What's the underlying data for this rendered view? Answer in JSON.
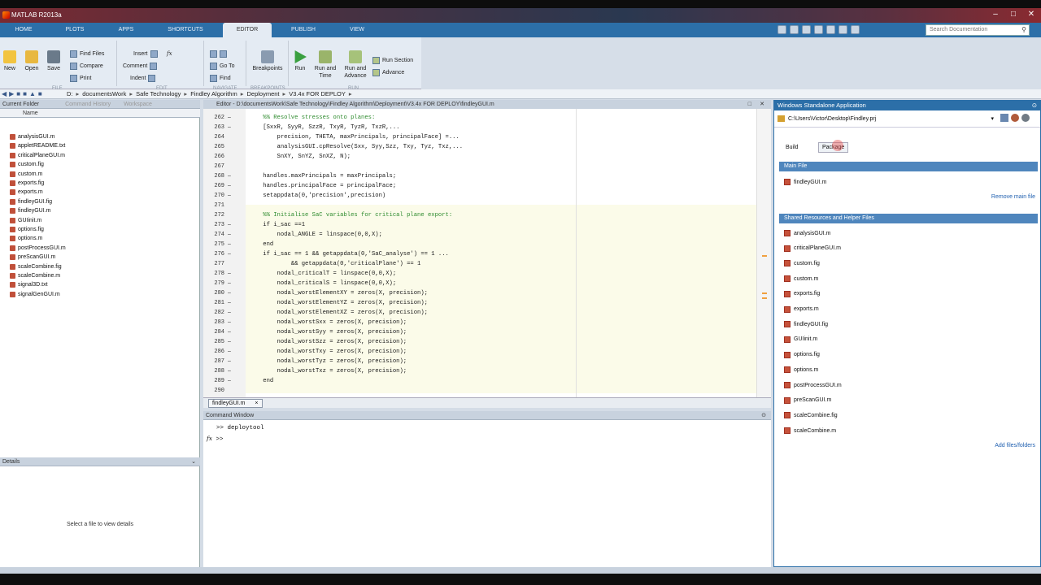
{
  "window": {
    "title": "MATLAB R2013a"
  },
  "tabs": [
    "HOME",
    "PLOTS",
    "APPS",
    "SHORTCUTS",
    "EDITOR",
    "PUBLISH",
    "VIEW"
  ],
  "active_tab": "EDITOR",
  "search": {
    "placeholder": "Search Documentation"
  },
  "ribbon": {
    "file": {
      "new": "New",
      "open": "Open",
      "save": "Save",
      "find_files": "Find Files",
      "compare": "Compare",
      "print": "Print",
      "section": "FILE"
    },
    "edit": {
      "insert": "Insert",
      "comment": "Comment",
      "indent": "Indent",
      "section": "EDIT"
    },
    "navigate": {
      "goto": "Go To",
      "find": "Find",
      "section": "NAVIGATE"
    },
    "breakpoints": {
      "label": "Breakpoints",
      "section": "BREAKPOINTS"
    },
    "run": {
      "run": "Run",
      "run_advance_1": "Run and",
      "run_advance_2": "Advance",
      "run_time_1": "Run and",
      "run_time_2": "Time",
      "run_section": "Run Section",
      "advance": "Advance",
      "section": "RUN"
    }
  },
  "address": {
    "crumbs": [
      "D:",
      "documentsWork",
      "Safe Technology",
      "Findley Algorithm",
      "Deployment",
      "V3.4x FOR DEPLOY"
    ]
  },
  "left_panel": {
    "tab_current": "Current Folder",
    "tab_history": "Command History",
    "tab_workspace": "Workspace",
    "col_name": "Name",
    "files": [
      "analysisGUI.m",
      "appletREADME.txt",
      "criticalPlaneGUI.m",
      "custom.fig",
      "custom.m",
      "exports.fig",
      "exports.m",
      "findleyGUI.fig",
      "findleyGUI.m",
      "GUIinit.m",
      "options.fig",
      "options.m",
      "postProcessGUI.m",
      "preScanGUI.m",
      "scaleCombine.fig",
      "scaleCombine.m",
      "signal3D.txt",
      "signalGenGUI.m"
    ],
    "details_label": "Details",
    "details_text": "Select a file to view details"
  },
  "editor": {
    "header": "Editor - D:\\documentsWork\\Safe Technology\\Findley Algorithm\\Deployment\\V3.4x FOR DEPLOY\\findleyGUI.m",
    "lines": [
      {
        "n": "262",
        "d": "–",
        "code": "    %% Resolve stresses onto planes:",
        "k": "cm"
      },
      {
        "n": "263",
        "d": "–",
        "code": "    [SxxR, SyyR, SzzR, TxyR, TyzR, TxzR,...",
        "k": ""
      },
      {
        "n": "264",
        "d": "",
        "code": "        precision, THETA, maxPrincipals, principalFace] =...",
        "k": ""
      },
      {
        "n": "265",
        "d": "",
        "code": "        analysisGUI.cpResolve(Sxx, Syy,Szz, Txy, Tyz, Txz,...",
        "k": ""
      },
      {
        "n": "266",
        "d": "",
        "code": "        SnXY, SnYZ, SnXZ, N);",
        "k": ""
      },
      {
        "n": "267",
        "d": "",
        "code": "",
        "k": ""
      },
      {
        "n": "268",
        "d": "–",
        "code": "    handles.maxPrincipals = maxPrincipals;",
        "k": ""
      },
      {
        "n": "269",
        "d": "–",
        "code": "    handles.principalFace = principalFace;",
        "k": ""
      },
      {
        "n": "270",
        "d": "–",
        "code": "    setappdata(0,'precision',precision)",
        "k": ""
      },
      {
        "n": "271",
        "d": "",
        "code": "",
        "k": ""
      },
      {
        "n": "272",
        "d": "",
        "code": "    %% Initialise SaC variables for critical plane export:",
        "k": "cm"
      },
      {
        "n": "273",
        "d": "–",
        "code": "    if i_sac ==1",
        "k": ""
      },
      {
        "n": "274",
        "d": "–",
        "code": "        nodal_ANGLE = linspace(0,0,X);",
        "k": ""
      },
      {
        "n": "275",
        "d": "–",
        "code": "    end",
        "k": ""
      },
      {
        "n": "276",
        "d": "–",
        "code": "    if i_sac == 1 && getappdata(0,'SaC_analyse') == 1 ...",
        "k": ""
      },
      {
        "n": "277",
        "d": "",
        "code": "            && getappdata(0,'criticalPlane') == 1",
        "k": ""
      },
      {
        "n": "278",
        "d": "–",
        "code": "        nodal_criticalT = linspace(0,0,X);",
        "k": ""
      },
      {
        "n": "279",
        "d": "–",
        "code": "        nodal_criticalS = linspace(0,0,X);",
        "k": ""
      },
      {
        "n": "280",
        "d": "–",
        "code": "        nodal_worstElementXY = zeros(X, precision);",
        "k": ""
      },
      {
        "n": "281",
        "d": "–",
        "code": "        nodal_worstElementYZ = zeros(X, precision);",
        "k": ""
      },
      {
        "n": "282",
        "d": "–",
        "code": "        nodal_worstElementXZ = zeros(X, precision);",
        "k": ""
      },
      {
        "n": "283",
        "d": "–",
        "code": "        nodal_worstSxx = zeros(X, precision);",
        "k": ""
      },
      {
        "n": "284",
        "d": "–",
        "code": "        nodal_worstSyy = zeros(X, precision);",
        "k": ""
      },
      {
        "n": "285",
        "d": "–",
        "code": "        nodal_worstSzz = zeros(X, precision);",
        "k": ""
      },
      {
        "n": "286",
        "d": "–",
        "code": "        nodal_worstTxy = zeros(X, precision);",
        "k": ""
      },
      {
        "n": "287",
        "d": "–",
        "code": "        nodal_worstTyz = zeros(X, precision);",
        "k": ""
      },
      {
        "n": "288",
        "d": "–",
        "code": "        nodal_worstTxz = zeros(X, precision);",
        "k": ""
      },
      {
        "n": "289",
        "d": "–",
        "code": "    end",
        "k": ""
      },
      {
        "n": "290",
        "d": "",
        "code": "",
        "k": ""
      }
    ],
    "file_tab": "findleyGUI.m"
  },
  "command_window": {
    "title": "Command Window",
    "prompt": ">>",
    "history": "deploytool",
    "fx": "fx"
  },
  "deploy": {
    "title": "Windows Standalone Application",
    "project_path": "C:\\Users\\Victor\\Desktop\\Findley.prj",
    "tab_build": "Build",
    "tab_package": "Package",
    "main_file_header": "Main File",
    "main_file": "findleyGUI.m",
    "remove_main": "Remove main file",
    "shared_header": "Shared Resources and Helper Files",
    "shared_files": [
      "analysisGUI.m",
      "criticalPlaneGUI.m",
      "custom.fig",
      "custom.m",
      "exports.fig",
      "exports.m",
      "findleyGUI.fig",
      "GUIinit.m",
      "options.fig",
      "options.m",
      "postProcessGUI.m",
      "preScanGUI.m",
      "scaleCombine.fig",
      "scaleCombine.m"
    ],
    "add_files": "Add files/folders"
  }
}
